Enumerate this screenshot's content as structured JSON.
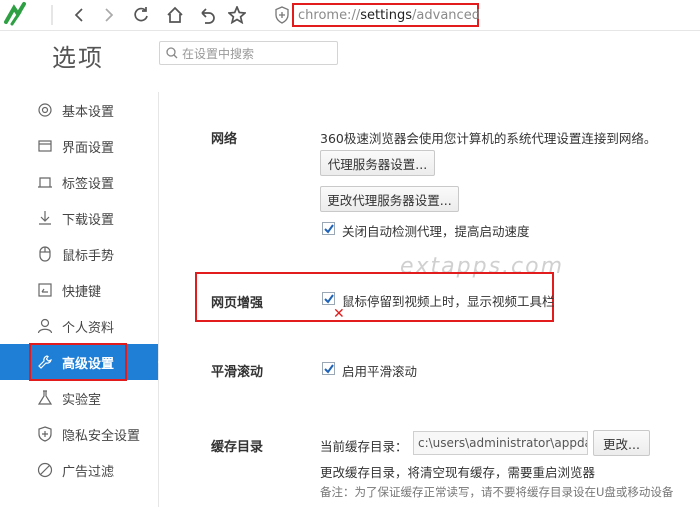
{
  "toolbar": {
    "url_scheme": "chrome://",
    "url_path": "settings",
    "url_suffix": "/advanced"
  },
  "page": {
    "title": "选项",
    "search_placeholder": "在设置中搜索"
  },
  "sidebar": {
    "items": [
      {
        "label": "基本设置",
        "icon": "gear-icon"
      },
      {
        "label": "界面设置",
        "icon": "window-icon"
      },
      {
        "label": "标签设置",
        "icon": "tab-icon"
      },
      {
        "label": "下载设置",
        "icon": "download-icon"
      },
      {
        "label": "鼠标手势",
        "icon": "mouse-icon"
      },
      {
        "label": "快捷键",
        "icon": "keyboard-icon"
      },
      {
        "label": "个人资料",
        "icon": "person-icon"
      },
      {
        "label": "高级设置",
        "icon": "wrench-icon",
        "active": true
      },
      {
        "label": "实验室",
        "icon": "flask-icon"
      },
      {
        "label": "隐私安全设置",
        "icon": "shield-plus-icon"
      },
      {
        "label": "广告过滤",
        "icon": "block-icon"
      }
    ]
  },
  "network": {
    "label": "网络",
    "description": "360极速浏览器会使用您计算机的系统代理设置连接到网络。",
    "proxy_button": "代理服务器设置...",
    "change_proxy_button": "更改代理服务器设置...",
    "auto_detect_label": "关闭自动检测代理，提高启动速度",
    "auto_detect_checked": true
  },
  "webpage_enhance": {
    "label": "网页增强",
    "video_toolbar_label": "鼠标停留到视频上时，显示视频工具栏",
    "video_toolbar_checked": true
  },
  "smooth_scroll": {
    "label": "平滑滚动",
    "enable_label": "启用平滑滚动",
    "enable_checked": true
  },
  "cache": {
    "label": "缓存目录",
    "current_label": "当前缓存目录：",
    "path_value": "c:\\users\\administrator\\appdata\\l",
    "change_button": "更改...",
    "change_note": "更改缓存目录，将清空现有缓存，需要重启浏览器",
    "warning_note": "备注：为了保证缓存正常读写，请不要将缓存目录设在U盘或移动设备"
  },
  "watermark": "extapps.com",
  "colors": {
    "accent": "#1f7fd6",
    "highlight_box": "#e21c1c",
    "logo_green": "#2ea043"
  }
}
